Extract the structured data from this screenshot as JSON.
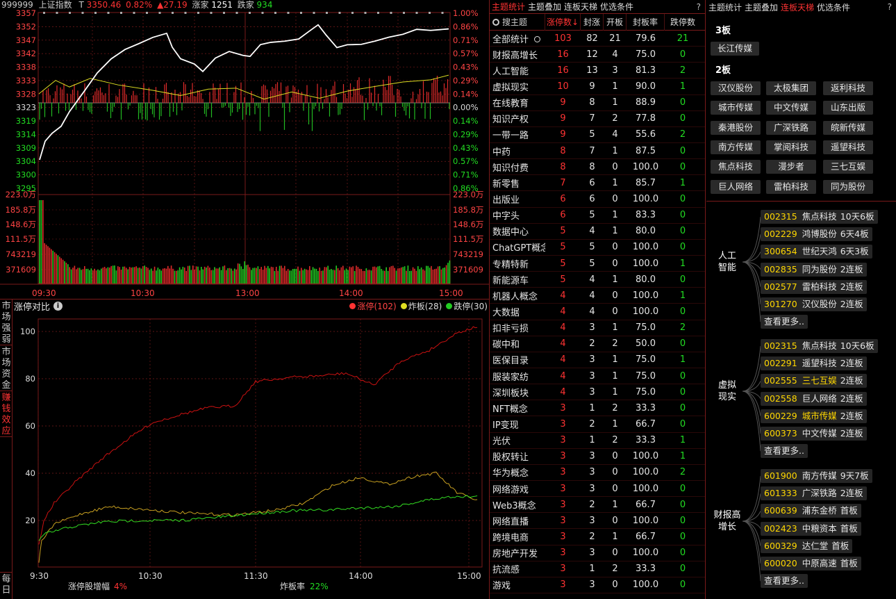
{
  "header": {
    "code": "999999",
    "name": "上证指数",
    "t_label": "T",
    "price": "3350.46",
    "pct": "0.82%",
    "change": "▲27.19",
    "up_label": "涨家",
    "up_count": "1251",
    "down_label": "跌家",
    "down_count": "934"
  },
  "intraday": {
    "left_ticks": [
      "3357",
      "3352",
      "3347",
      "3342",
      "3338",
      "3333",
      "3328",
      "3323",
      "3319",
      "3314",
      "3309",
      "3304",
      "3300",
      "3295"
    ],
    "right_ticks": [
      "1.00%",
      "0.86%",
      "0.71%",
      "0.57%",
      "0.43%",
      "0.29%",
      "0.14%",
      "0.00%",
      "0.14%",
      "0.29%",
      "0.43%",
      "0.57%",
      "0.71%",
      "0.86%"
    ],
    "vol_ticks": [
      "223.0万",
      "185.8万",
      "148.6万",
      "111.5万",
      "743219",
      "371609"
    ],
    "time_ticks": [
      "09:30",
      "10:30",
      "13:00",
      "14:00",
      "15:00"
    ]
  },
  "compare": {
    "title": "涨停对比",
    "info_icon": "info-icon",
    "legend": [
      {
        "label": "涨停(102)",
        "color": "#ff3333"
      },
      {
        "label": "炸板(28)",
        "color": "#dddd22"
      },
      {
        "label": "跌停(30)",
        "color": "#22cc22"
      }
    ],
    "y_ticks": [
      "100",
      "80",
      "60",
      "40",
      "20"
    ],
    "x_ticks": [
      "9:30",
      "10:30",
      "11:30",
      "14:00",
      "15:00"
    ],
    "foot_left_label": "涨停股增幅",
    "foot_left_value": "4%",
    "foot_right_label": "炸板率",
    "foot_right_value": "22%"
  },
  "side_tabs": [
    "市场强弱",
    "市场资金",
    "赚钱效应"
  ],
  "side_bottom": "每日",
  "sector": {
    "tabs": [
      "主题统计",
      "主题叠加",
      "连板天梯",
      "优选条件"
    ],
    "active": 0,
    "help": "?",
    "search_placeholder": "搜主题",
    "headers": [
      "涨停数↓",
      "封涨",
      "开板",
      "封板率",
      "跌停数"
    ],
    "rows": [
      [
        "全部统计",
        "103",
        "82",
        "21",
        "79.6",
        "21"
      ],
      [
        "财报高增长",
        "16",
        "12",
        "4",
        "75.0",
        "0"
      ],
      [
        "人工智能",
        "16",
        "13",
        "3",
        "81.3",
        "2"
      ],
      [
        "虚拟现实",
        "10",
        "9",
        "1",
        "90.0",
        "1"
      ],
      [
        "在线教育",
        "9",
        "8",
        "1",
        "88.9",
        "0"
      ],
      [
        "知识产权",
        "9",
        "7",
        "2",
        "77.8",
        "0"
      ],
      [
        "一带一路",
        "9",
        "5",
        "4",
        "55.6",
        "2"
      ],
      [
        "中药",
        "8",
        "7",
        "1",
        "87.5",
        "0"
      ],
      [
        "知识付费",
        "8",
        "8",
        "0",
        "100.0",
        "0"
      ],
      [
        "新零售",
        "7",
        "6",
        "1",
        "85.7",
        "1"
      ],
      [
        "出版业",
        "6",
        "6",
        "0",
        "100.0",
        "0"
      ],
      [
        "中字头",
        "6",
        "5",
        "1",
        "83.3",
        "0"
      ],
      [
        "数据中心",
        "5",
        "4",
        "1",
        "80.0",
        "0"
      ],
      [
        "ChatGPT概念",
        "5",
        "5",
        "0",
        "100.0",
        "0"
      ],
      [
        "专精特新",
        "5",
        "5",
        "0",
        "100.0",
        "1"
      ],
      [
        "新能源车",
        "5",
        "4",
        "1",
        "80.0",
        "0"
      ],
      [
        "机器人概念",
        "4",
        "4",
        "0",
        "100.0",
        "1"
      ],
      [
        "大数据",
        "4",
        "4",
        "0",
        "100.0",
        "0"
      ],
      [
        "扣非亏损",
        "4",
        "3",
        "1",
        "75.0",
        "2"
      ],
      [
        "碳中和",
        "4",
        "2",
        "2",
        "50.0",
        "0"
      ],
      [
        "医保目录",
        "4",
        "3",
        "1",
        "75.0",
        "1"
      ],
      [
        "服装家纺",
        "4",
        "3",
        "1",
        "75.0",
        "0"
      ],
      [
        "深圳板块",
        "4",
        "3",
        "1",
        "75.0",
        "0"
      ],
      [
        "NFT概念",
        "3",
        "1",
        "2",
        "33.3",
        "0"
      ],
      [
        "IP变现",
        "3",
        "2",
        "1",
        "66.7",
        "0"
      ],
      [
        "光伏",
        "3",
        "1",
        "2",
        "33.3",
        "1"
      ],
      [
        "股权转让",
        "3",
        "3",
        "0",
        "100.0",
        "1"
      ],
      [
        "华为概念",
        "3",
        "3",
        "0",
        "100.0",
        "2"
      ],
      [
        "网络游戏",
        "3",
        "3",
        "0",
        "100.0",
        "0"
      ],
      [
        "Web3概念",
        "3",
        "2",
        "1",
        "66.7",
        "0"
      ],
      [
        "网络直播",
        "3",
        "3",
        "0",
        "100.0",
        "0"
      ],
      [
        "跨境电商",
        "3",
        "2",
        "1",
        "66.7",
        "0"
      ],
      [
        "房地产开发",
        "3",
        "3",
        "0",
        "100.0",
        "0"
      ],
      [
        "抗流感",
        "3",
        "1",
        "2",
        "33.3",
        "0"
      ],
      [
        "游戏",
        "3",
        "3",
        "0",
        "100.0",
        "0"
      ]
    ]
  },
  "ladder": {
    "tabs": [
      "主题统计",
      "主题叠加",
      "连板天梯",
      "优选条件"
    ],
    "active": 2,
    "help": "?",
    "levels": [
      {
        "label": "3板",
        "stocks": [
          "长江传媒"
        ]
      },
      {
        "label": "2板",
        "stocks": [
          "汉仪股份",
          "太极集团",
          "返利科技",
          "城市传媒",
          "中文传媒",
          "山东出版",
          "秦港股份",
          "广深铁路",
          "皖新传媒",
          "南方传媒",
          "掌阅科技",
          "遥望科技",
          "焦点科技",
          "漫步者",
          "三七互娱",
          "巨人网络",
          "雷柏科技",
          "同为股份"
        ]
      }
    ]
  },
  "groups": [
    {
      "label": "人工智能",
      "label_lines": [
        "人工",
        "智能"
      ],
      "stocks": [
        [
          "002315",
          "焦点科技",
          "10天6板",
          false
        ],
        [
          "002229",
          "鸿博股份",
          "6天4板",
          false
        ],
        [
          "300654",
          "世纪天鸿",
          "6天3板",
          false
        ],
        [
          "002835",
          "同为股份",
          "2连板",
          false
        ],
        [
          "002577",
          "雷柏科技",
          "2连板",
          false
        ],
        [
          "301270",
          "汉仪股份",
          "2连板",
          false
        ]
      ]
    },
    {
      "label": "虚拟现实",
      "label_lines": [
        "虚拟",
        "现实"
      ],
      "stocks": [
        [
          "002315",
          "焦点科技",
          "10天6板",
          false
        ],
        [
          "002291",
          "遥望科技",
          "2连板",
          false
        ],
        [
          "002555",
          "三七互娱",
          "2连板",
          true
        ],
        [
          "002558",
          "巨人网络",
          "2连板",
          false
        ],
        [
          "600229",
          "城市传媒",
          "2连板",
          true
        ],
        [
          "600373",
          "中文传媒",
          "2连板",
          false
        ]
      ]
    },
    {
      "label": "财报高增长",
      "label_lines": [
        "财报高",
        "增长"
      ],
      "stocks": [
        [
          "601900",
          "南方传媒",
          "9天7板",
          false
        ],
        [
          "601333",
          "广深铁路",
          "2连板",
          false
        ],
        [
          "600639",
          "浦东金桥",
          "首板",
          false
        ],
        [
          "002423",
          "中粮资本",
          "首板",
          false
        ],
        [
          "600329",
          "达仁堂",
          "首板",
          false
        ],
        [
          "600020",
          "中原高速",
          "首板",
          false
        ]
      ]
    }
  ],
  "more_label": "查看更多..",
  "colors": {
    "up": "#ff3333",
    "down": "#22dd22",
    "zhaban": "#dddd22",
    "white": "#ffffff",
    "avg": "#dddd22"
  }
}
